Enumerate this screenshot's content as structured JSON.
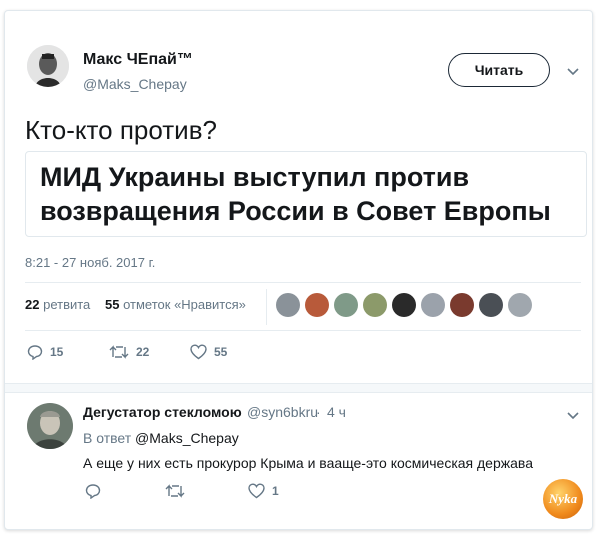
{
  "tweet": {
    "author": {
      "display_name": "Макс ЧЕпай™",
      "handle": "@Maks_Chepay"
    },
    "follow_label": "Читать",
    "text": "Кто-кто против?",
    "quote_headline": "МИД Украины выступил против возвращения России в Совет Европы",
    "timestamp": "8:21 - 27 нояб. 2017 г.",
    "stats": {
      "retweets_count": "22",
      "retweets_label": "ретвита",
      "likes_count": "55",
      "likes_label": "отметок «Нравится»"
    },
    "liker_avatar_colors": [
      "#8a9299",
      "#b85a3a",
      "#7f9a88",
      "#8c9a6a",
      "#2a2a2a",
      "#9ba2ab",
      "#7a3a2e",
      "#4a4f55",
      "#a0a7ae"
    ],
    "actions": {
      "reply_count": "15",
      "retweet_count": "22",
      "like_count": "55"
    }
  },
  "reply": {
    "display_name": "Дегустатор стекломою",
    "handle": "@syn6bkru",
    "time": "4 ч",
    "in_reply_prefix": "В ответ",
    "in_reply_mention": "@Maks_Chepay",
    "text": "А еще у них есть прокурор Крыма и вааще-это космическая держава",
    "actions": {
      "like_count": "1"
    }
  },
  "watermark": "Nyka",
  "colors": {
    "text": "#14171a",
    "muted": "#657786",
    "border": "#e1e8ed",
    "badge": "#f08a1c"
  }
}
